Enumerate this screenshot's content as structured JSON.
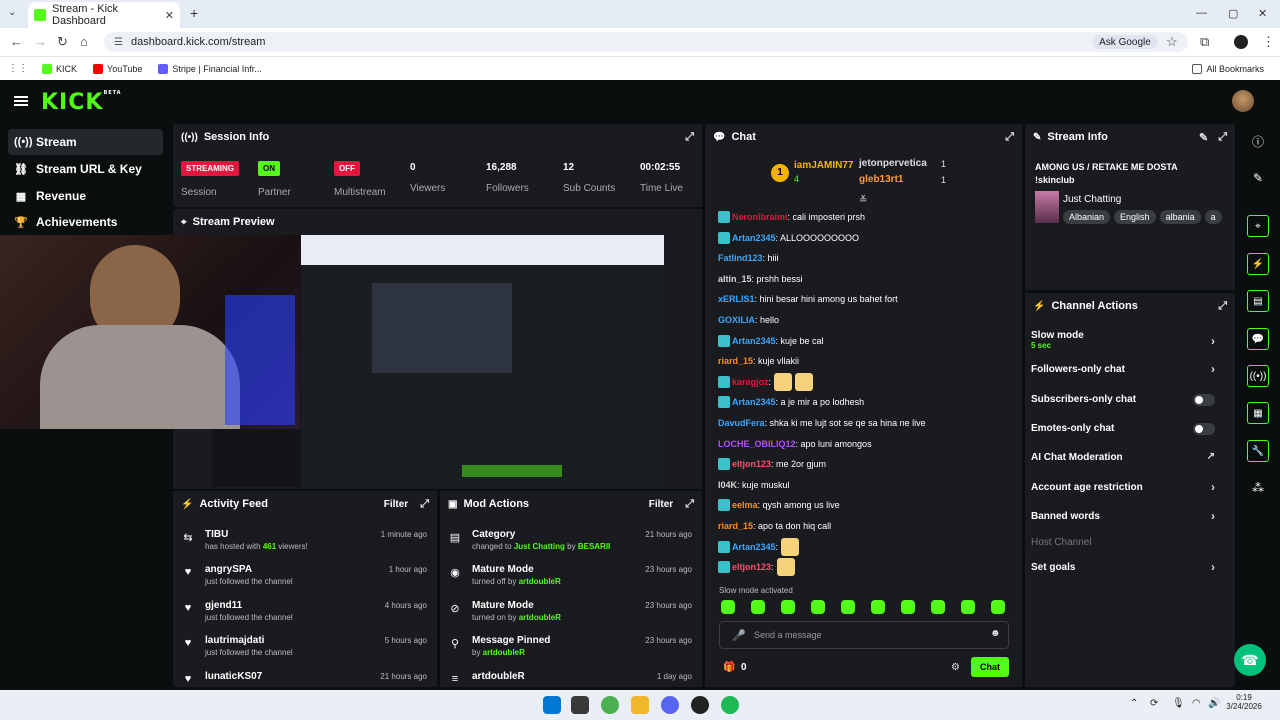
{
  "browser": {
    "tab_title": "Stream - Kick Dashboard",
    "url": "dashboard.kick.com/stream",
    "ask_google": "Ask Google",
    "bookmarks": [
      "KICK",
      "YouTube",
      "Stripe | Financial Infr..."
    ],
    "all_bookmarks": "All Bookmarks"
  },
  "app": {
    "logo": "KICK",
    "logo_beta": "BETA"
  },
  "sidebar": {
    "items": [
      {
        "label": "Stream",
        "icon": "broadcast-icon"
      },
      {
        "label": "Stream URL & Key",
        "icon": "link-icon"
      },
      {
        "label": "Revenue",
        "icon": "revenue-icon"
      },
      {
        "label": "Achievements",
        "icon": "trophy-icon"
      }
    ]
  },
  "session": {
    "title": "Session Info",
    "session_badge": "STREAMING",
    "session_label": "Session",
    "partner_badge": "ON",
    "partner_label": "Partner Income",
    "multistream_badge": "OFF",
    "multistream_label": "Multistream",
    "viewers": "0",
    "viewers_label": "Viewers",
    "followers": "16,288",
    "followers_label": "Followers",
    "subs": "12",
    "subs_label": "Sub Counts",
    "time": "00:02:55",
    "time_label": "Time Live"
  },
  "preview": {
    "title": "Stream Preview"
  },
  "activity": {
    "title": "Activity Feed",
    "filter": "Filter",
    "items": [
      {
        "name": "TIBU",
        "sub_pre": "has hosted with ",
        "sub_hl": "461",
        "sub_post": " viewers!",
        "time": "1 minute ago",
        "icon": "host-icon"
      },
      {
        "name": "angrySPA",
        "sub_pre": "just followed the channel",
        "sub_hl": "",
        "sub_post": "",
        "time": "1 hour ago",
        "icon": "heart-icon"
      },
      {
        "name": "gjend11",
        "sub_pre": "just followed the channel",
        "sub_hl": "",
        "sub_post": "",
        "time": "4 hours ago",
        "icon": "heart-icon"
      },
      {
        "name": "lautrimajdati",
        "sub_pre": "just followed the channel",
        "sub_hl": "",
        "sub_post": "",
        "time": "5 hours ago",
        "icon": "heart-icon"
      },
      {
        "name": "lunaticKS07",
        "sub_pre": "",
        "sub_hl": "",
        "sub_post": "",
        "time": "21 hours ago",
        "icon": "heart-icon"
      }
    ]
  },
  "mod": {
    "title": "Mod Actions",
    "filter": "Filter",
    "items": [
      {
        "name": "Category",
        "sub_pre": "changed to ",
        "hl1": "Just Chatting",
        "mid": " by ",
        "hl2": "BESARII",
        "time": "21 hours ago",
        "icon": "category-icon"
      },
      {
        "name": "Mature Mode",
        "sub_pre": "turned off by ",
        "hl1": "artdoubleR",
        "mid": "",
        "hl2": "",
        "time": "23 hours ago",
        "icon": "eye-icon"
      },
      {
        "name": "Mature Mode",
        "sub_pre": "turned on by ",
        "hl1": "artdoubleR",
        "mid": "",
        "hl2": "",
        "time": "23 hours ago",
        "icon": "eye-off-icon"
      },
      {
        "name": "Message Pinned",
        "sub_pre": "by ",
        "hl1": "artdoubleR",
        "mid": "",
        "hl2": "",
        "time": "23 hours ago",
        "icon": "pin-icon"
      },
      {
        "name": "artdoubleR",
        "sub_pre": "",
        "hl1": "",
        "mid": "",
        "hl2": "",
        "time": "1 day ago",
        "icon": "user-icon"
      }
    ]
  },
  "chat": {
    "title": "Chat",
    "top_gifter": {
      "name": "iamJAMIN77",
      "count": "4",
      "rank": "1"
    },
    "others": [
      {
        "name": "jetonpervetica",
        "count": "1"
      },
      {
        "name": "gleb13rt1",
        "count": "1"
      }
    ],
    "messages": [
      {
        "user": "Neronlbraimi",
        "color": "#e4163e",
        "text": ": cali imposteri prsh",
        "badge": true
      },
      {
        "user": "Artan2345",
        "color": "#3aa7ff",
        "text": ": ALLOOOOOOOOO",
        "badge": true
      },
      {
        "user": "Fatlind123",
        "color": "#3aa7ff",
        "text": ": hiii",
        "badge": false
      },
      {
        "user": "altin_15",
        "color": "#d7d7d7",
        "text": ": prshh bessi",
        "badge": false
      },
      {
        "user": "xERLIS1",
        "color": "#3aa7ff",
        "text": ": hini besar hini among us bahet fort",
        "badge": false
      },
      {
        "user": "GOXILIA",
        "color": "#3aa7ff",
        "text": ": hello",
        "badge": false
      },
      {
        "user": "Artan2345",
        "color": "#3aa7ff",
        "text": ": kuje be cal",
        "badge": true
      },
      {
        "user": "riard_15",
        "color": "#ff8c1a",
        "text": ": kuje vllakii",
        "badge": false
      },
      {
        "user": "karagjoz",
        "color": "#e4163e",
        "text": ": ",
        "badge": true,
        "emotes": 2
      },
      {
        "user": "Artan2345",
        "color": "#3aa7ff",
        "text": ": a je mir a po lodhesh",
        "badge": true
      },
      {
        "user": "DavudFera",
        "color": "#3aa7ff",
        "text": ": shka ki me lujt sot se qe sa hina ne live",
        "badge": false
      },
      {
        "user": "LOCHE_OBILIQ12",
        "color": "#b44dff",
        "text": ": apo luni amongos",
        "badge": false
      },
      {
        "user": "eltjon123",
        "color": "#ff4d6d",
        "text": ": me 2or gjum",
        "badge": true
      },
      {
        "user": "I04K",
        "color": "#d7d7d7",
        "text": ": kuje muskul",
        "badge": false
      },
      {
        "user": "eelma",
        "color": "#ff8c1a",
        "text": ": qysh among us live",
        "badge": true
      },
      {
        "user": "riard_15",
        "color": "#ff8c1a",
        "text": ": apo ta don hiq call",
        "badge": false
      },
      {
        "user": "Artan2345",
        "color": "#3aa7ff",
        "text": ": ",
        "badge": true,
        "emotes": 1
      },
      {
        "user": "eltjon123",
        "color": "#ff4d6d",
        "text": ": ",
        "badge": true,
        "emotes": 1
      }
    ],
    "slow_mode_notice": "Slow mode activated",
    "placeholder": "Send a message",
    "points": "0",
    "send": "Chat"
  },
  "stream_info": {
    "title": "Stream Info",
    "stream_title": "AMONG US / RETAKE ME DOSTA !skinclub",
    "category": "Just Chatting",
    "tags": [
      "Albanian",
      "English",
      "albania",
      "a"
    ]
  },
  "channel_actions": {
    "title": "Channel Actions",
    "slow_mode": "Slow mode",
    "slow_mode_value": "5 sec",
    "followers_only": "Followers-only chat",
    "subscribers_only": "Subscribers-only chat",
    "emotes_only": "Emotes-only chat",
    "ai_mod": "AI Chat Moderation",
    "account_age": "Account age restriction",
    "banned_words": "Banned words",
    "host_channel": "Host Channel",
    "set_goals": "Set goals"
  },
  "taskbar": {
    "time": "0:19",
    "date": "3/24/2026"
  },
  "colors": {
    "accent": "#53fc18",
    "panel": "#191b1f",
    "bg": "#0b0e0f",
    "live": "#e4163e"
  }
}
